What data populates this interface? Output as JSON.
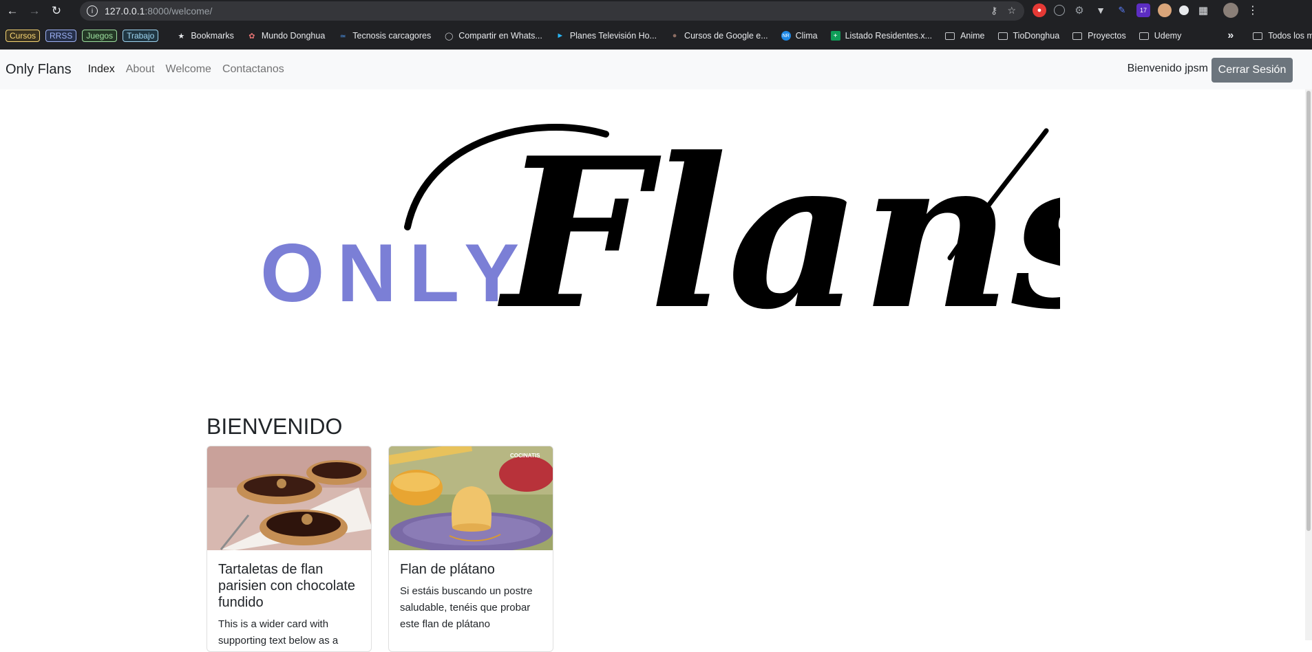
{
  "browser": {
    "url_host": "127.0.0.1",
    "url_path": ":8000/welcome/",
    "bookmark_tags": [
      {
        "label": "Cursos",
        "color": "#f9d774"
      },
      {
        "label": "RRSS",
        "color": "#9fb3f7"
      },
      {
        "label": "Juegos",
        "color": "#9ee0a0"
      },
      {
        "label": "Trabajo",
        "color": "#9fd6f2"
      }
    ],
    "bookmarks": [
      {
        "label": "Bookmarks",
        "icon": "star-icon"
      },
      {
        "label": "Mundo Donghua",
        "icon": "site-icon"
      },
      {
        "label": "Tecnosis carcagores",
        "icon": "site-icon"
      },
      {
        "label": "Compartir en Whats...",
        "icon": "globe-icon"
      },
      {
        "label": "Planes Televisión Ho...",
        "icon": "play-icon"
      },
      {
        "label": "Cursos de Google e...",
        "icon": "site-icon"
      },
      {
        "label": "Clima",
        "icon": "site-icon"
      },
      {
        "label": "Listado Residentes.x...",
        "icon": "sheet-icon"
      }
    ],
    "folders": [
      "Anime",
      "TioDonghua",
      "Proyectos",
      "Udemy"
    ],
    "all_bookmarks": "Todos los marcadores",
    "overflow": "»",
    "ext_badge": "17"
  },
  "site": {
    "brand": "Only Flans",
    "nav": [
      "Index",
      "About",
      "Welcome",
      "Contactanos"
    ],
    "active_nav": "Index",
    "greeting": "Bienvenido jpsm",
    "logout": "Cerrar Sesión"
  },
  "logo": {
    "only": "ONLY",
    "flans": "Flans",
    "only_color": "#7b7fd6",
    "flans_color": "#000000"
  },
  "heading": "BIENVENIDO",
  "cards": [
    {
      "title": "Tartaletas de flan parisien con chocolate fundido",
      "text": "This is a wider card with supporting text below as a"
    },
    {
      "title": "Flan de plátano",
      "text": "Si estáis buscando un postre saludable, tenéis que probar este flan de plátano",
      "watermark": "COCINATIS"
    }
  ]
}
